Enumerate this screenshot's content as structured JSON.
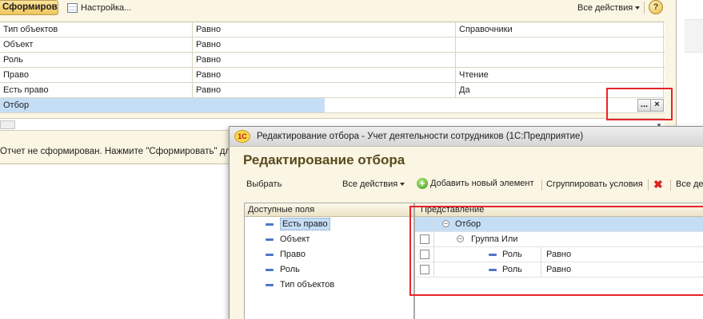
{
  "report": {
    "toolbar": {
      "generate_label": "Сформировать",
      "settings_label": "Настройка...",
      "all_actions_label": "Все действия",
      "help_label": "?"
    },
    "settings_rows": [
      {
        "name": "Тип объектов",
        "condition": "Равно",
        "value": "Справочники"
      },
      {
        "name": "Объект",
        "condition": "Равно",
        "value": ""
      },
      {
        "name": "Роль",
        "condition": "Равно",
        "value": ""
      },
      {
        "name": "Право",
        "condition": "Равно",
        "value": "Чтение"
      },
      {
        "name": "Есть право",
        "condition": "Равно",
        "value": "Да"
      }
    ],
    "selected_row": {
      "name": "Отбор",
      "choose_label": "...",
      "clear_label": "×"
    },
    "status_text": "Отчет не сформирован. Нажмите \"Сформировать\" для п"
  },
  "dialog": {
    "title": "Редактирование отбора - Учет деятельности сотрудников  (1С:Предприятие)",
    "logo_text": "1С",
    "heading": "Редактирование отбора",
    "left_toolbar": {
      "select_label": "Выбрать",
      "all_actions_label": "Все действия"
    },
    "right_toolbar": {
      "add_label": "Добавить новый элемент",
      "group_label": "Сгруппировать условия",
      "all_actions_label": "Все де"
    },
    "available_fields": {
      "header": "Доступные поля",
      "items": [
        "Есть право",
        "Объект",
        "Право",
        "Роль",
        "Тип объектов"
      ]
    },
    "conditions": {
      "header": "Представление",
      "root": "Отбор",
      "group": "Группа Или",
      "items": [
        {
          "field": "Роль",
          "operator": "Равно"
        },
        {
          "field": "Роль",
          "operator": "Равно"
        }
      ]
    }
  }
}
